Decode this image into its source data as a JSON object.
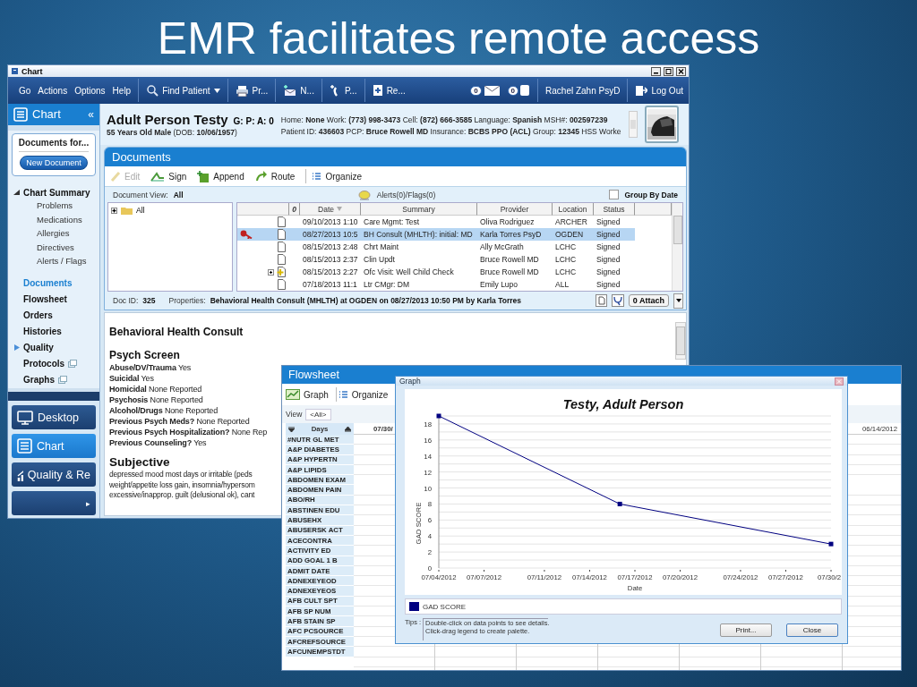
{
  "slide_title": "EMR facilitates remote access",
  "chart_window": {
    "title": "Chart",
    "menu": [
      "Go",
      "Actions",
      "Options",
      "Help"
    ],
    "toolbar": [
      {
        "label": "Find Patient",
        "kind": "search"
      },
      {
        "label": "Pr...",
        "kind": "print"
      },
      {
        "label": "N...",
        "kind": "message"
      },
      {
        "label": "P...",
        "kind": "phone"
      },
      {
        "label": "Re...",
        "kind": "record"
      }
    ],
    "mail_count": "0",
    "alert_count": "0",
    "user": "Rachel Zahn PsyD",
    "logout": "Log Out",
    "sidebar": {
      "title": "Chart",
      "collapse": "«",
      "documents_for": "Documents for...",
      "new_document": "New Document",
      "items": [
        {
          "label": "Chart Summary",
          "selected": false,
          "popout": false,
          "expanded": true,
          "children": [
            {
              "label": "Problems",
              "selected": false
            },
            {
              "label": "Medications",
              "selected": false
            },
            {
              "label": "Allergies",
              "selected": false
            },
            {
              "label": "Directives",
              "selected": false
            },
            {
              "label": "Alerts / Flags",
              "selected": false
            }
          ]
        },
        {
          "label": "Documents",
          "selected": true,
          "popout": false
        },
        {
          "label": "Flowsheet",
          "selected": false,
          "popout": false
        },
        {
          "label": "Orders",
          "selected": false,
          "popout": false
        },
        {
          "label": "Histories",
          "selected": false,
          "popout": false
        },
        {
          "label": "Quality",
          "selected": false,
          "popout": false,
          "expanded": false
        },
        {
          "label": "Protocols",
          "selected": false,
          "popout": true
        },
        {
          "label": "Graphs",
          "selected": false,
          "popout": true
        }
      ]
    },
    "nav": [
      {
        "label": "Desktop",
        "kind": "desktop",
        "selected": false
      },
      {
        "label": "Chart",
        "kind": "chart",
        "selected": true
      },
      {
        "label": "Quality & Re",
        "kind": "quality",
        "selected": false
      },
      {
        "label": "▸",
        "kind": "more",
        "selected": false
      }
    ],
    "patient": {
      "name": "Adult Person Testy",
      "gpa": "G: P: A: 0",
      "demographics": "**55 Years Old Male** (DOB: **10/06/1957**)",
      "contact": "Home: **None** Work: **(773) 998-3473** Cell: **(872) 666-3585** Language: **Spanish** MSH#: **002597239**",
      "ids": "Patient ID: **436603** PCP: **Bruce Rowell MD** Insurance: **BCBS PPO (ACL)** Group: **12345** HSS Worke"
    },
    "documents": {
      "title": "Documents",
      "actions": [
        {
          "label": "Edit",
          "kind": "edit",
          "disabled": true
        },
        {
          "label": "Sign",
          "kind": "sign",
          "disabled": false
        },
        {
          "label": "Append",
          "kind": "append",
          "disabled": false
        },
        {
          "label": "Route",
          "kind": "route",
          "disabled": false
        },
        {
          "label": "Organize",
          "kind": "organize",
          "disabled": false
        }
      ],
      "view_label": "Document View:",
      "view_value": "All",
      "alerts": "Alerts(0)/Flags(0)",
      "group_by_date": {
        "label": "Group By Date",
        "checked": false
      },
      "tree": [
        {
          "label": "All",
          "expanded": false
        }
      ],
      "columns": [
        "0",
        "Date",
        "Summary",
        "Provider",
        "Location",
        "Status"
      ],
      "rows": [
        {
          "date": "09/10/2013 1:10",
          "summary": "Care Mgmt: Test",
          "provider": "Oliva Rodriguez",
          "location": "ARCHER",
          "status": "Signed",
          "key": false,
          "expandable": false,
          "selected": false
        },
        {
          "date": "08/27/2013 10:5",
          "summary": "BH Consult (MHLTH): initial: MD",
          "provider": "Karla Torres PsyD",
          "location": "OGDEN",
          "status": "Signed",
          "key": true,
          "expandable": false,
          "selected": true
        },
        {
          "date": "08/15/2013 2:48",
          "summary": "Chrt Maint",
          "provider": "Ally McGrath",
          "location": "LCHC",
          "status": "Signed",
          "key": false,
          "expandable": false,
          "selected": false
        },
        {
          "date": "08/15/2013 2:37",
          "summary": "Clin Updt",
          "provider": "Bruce Rowell MD",
          "location": "LCHC",
          "status": "Signed",
          "key": false,
          "expandable": false,
          "selected": false
        },
        {
          "date": "08/15/2013 2:27",
          "summary": "Ofc Visit: Well Child Check",
          "provider": "Bruce Rowell MD",
          "location": "LCHC",
          "status": "Signed",
          "key": false,
          "expandable": true,
          "selected": false
        },
        {
          "date": "07/18/2013 11:1",
          "summary": "Ltr CMgr: DM",
          "provider": "Emily Lupo",
          "location": "ALL",
          "status": "Signed",
          "key": false,
          "expandable": false,
          "selected": false
        }
      ],
      "doc_id_label": "Doc ID:",
      "doc_id": "325",
      "properties_label": "Properties:",
      "properties": "Behavioral Health Consult (MHLTH) at OGDEN on 08/27/2013 10:50 PM by Karla Torres",
      "attach": "0 Attach"
    },
    "note": {
      "title": "Behavioral Health Consult",
      "sections": [
        {
          "heading": "Psych Screen",
          "lines": [
            "**Abuse/DV/Trauma** Yes",
            "**Suicidal** Yes",
            "**Homicidal** None Reported",
            "**Psychosis** None Reported",
            "**Alcohol/Drugs** None Reported",
            "**Previous Psych Meds?** None Reported",
            "**Previous Psych Hospitalization?** None Rep",
            "**Previous Counseling?** Yes"
          ]
        },
        {
          "heading": "Subjective",
          "lines": [
            "depressed mood most days or irritable (peds",
            "weight/appetite loss gain, insomnia/hypersom",
            "excessive/inapprop. guilt (delusional ok), cant"
          ]
        }
      ]
    }
  },
  "flowsheet": {
    "title": "Flowsheet",
    "tools": [
      {
        "label": "Graph",
        "kind": "graph"
      },
      {
        "label": "Organize",
        "kind": "organize"
      }
    ],
    "view_label": "View",
    "view_value": "<All>",
    "row_header": "Days",
    "columns": [
      "07/30/",
      "06/14/2012"
    ],
    "rows": [
      "#NUTR GL MET",
      "A&P DIABETES",
      "A&P HYPERTN",
      "A&P LIPIDS",
      "ABDOMEN EXAM",
      "ABDOMEN PAIN",
      "ABO/RH",
      "ABSTINEN EDU",
      "ABUSEHX",
      "ABUSERSK ACT",
      "ACECONTRA",
      "ACTIVITY ED",
      "ADD GOAL 1 B",
      "ADMIT DATE",
      "ADNEXEYEOD",
      "ADNEXEYEOS",
      "AFB CULT SPT",
      "AFB SP NUM",
      "AFB STAIN SP",
      "AFC PCSOURCE",
      "AFCREFSOURCE",
      "AFCUNEMPSTDT"
    ]
  },
  "graph": {
    "title": "Graph",
    "tips_label": "Tips :",
    "tips": [
      "Double-click on data points to see details.",
      "Click-drag legend to create palette."
    ],
    "buttons": [
      {
        "label": "Print...",
        "kind": "print"
      },
      {
        "label": "Close",
        "kind": "close"
      }
    ],
    "chart_data": {
      "type": "line",
      "title": "Testy, Adult Person",
      "xlabel": "Date",
      "ylabel": "GAD SCORE",
      "categories": [
        "07/04/2012",
        null,
        null,
        "07/07/2012",
        null,
        null,
        null,
        "07/11/2012",
        null,
        null,
        "07/14/2012",
        null,
        null,
        "07/17/2012",
        null,
        null,
        "07/20/2012",
        null,
        null,
        null,
        "07/24/2012",
        null,
        null,
        "07/27/2012",
        null,
        null,
        "07/30/2"
      ],
      "grid": true,
      "series": [
        {
          "name": "GAD SCORE",
          "color": "#000080",
          "marker": "square",
          "values": [
            19,
            null,
            null,
            null,
            null,
            null,
            null,
            null,
            null,
            null,
            null,
            null,
            8,
            null,
            null,
            null,
            null,
            null,
            null,
            null,
            null,
            null,
            null,
            null,
            null,
            null,
            3
          ]
        }
      ],
      "ylim": [
        0,
        19
      ],
      "yticks": [
        0,
        2,
        4,
        6,
        8,
        10,
        12,
        14,
        16,
        18
      ]
    }
  }
}
